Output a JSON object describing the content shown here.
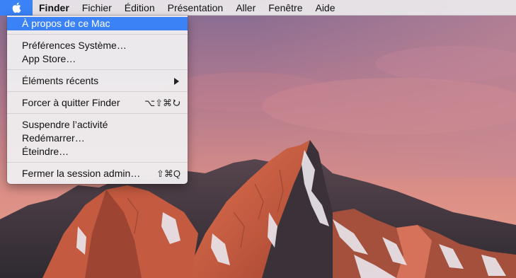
{
  "menubar": {
    "apple_icon": "apple-logo-icon",
    "items": [
      {
        "label": "Finder",
        "bold": true
      },
      {
        "label": "Fichier"
      },
      {
        "label": "Édition"
      },
      {
        "label": "Présentation"
      },
      {
        "label": "Aller"
      },
      {
        "label": "Fenêtre"
      },
      {
        "label": "Aide"
      }
    ]
  },
  "apple_menu": {
    "items": [
      {
        "label": "À propos de ce Mac",
        "selected": true
      },
      {
        "label": "Préférences Système…"
      },
      {
        "label": "App Store…"
      },
      {
        "label": "Éléments récents",
        "submenu": true,
        "submenu_icon": "chevron-right-icon"
      },
      {
        "label": "Forcer à quitter Finder",
        "shortcut": "⌥⇧⌘⎋",
        "shortcut_text": "⌥⇧⌘"
      },
      {
        "label": "Suspendre l’activité"
      },
      {
        "label": "Redémarrer…"
      },
      {
        "label": "Éteindre…"
      },
      {
        "label": "Fermer la session admin…",
        "shortcut": "⇧⌘Q"
      }
    ]
  },
  "colors": {
    "highlight": "#3a82f6",
    "menu_bg": "#eeecee",
    "sky_top": "#8a6f95",
    "sky_bottom": "#e1958a",
    "mountain_shadow": "#3d3640",
    "mountain_lit": "#d0664a"
  }
}
